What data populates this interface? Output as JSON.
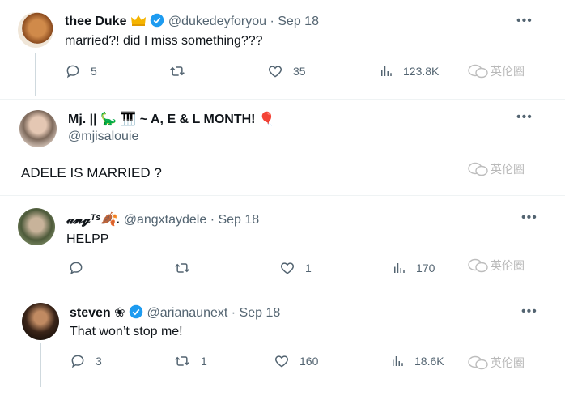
{
  "tweet1": {
    "name": "thee Duke",
    "handle": "@dukedeyforyou",
    "date": "· Sep 18",
    "text": "married?! did I miss something???",
    "replies": "5",
    "likes": "35",
    "views": "123.8K",
    "emoji": [
      "crown-icon",
      "verified-icon"
    ]
  },
  "tweet2": {
    "name": "Mj. || 🦕 🎹 ~ A, E & L MONTH! 🎈",
    "handle": "@mjisalouie",
    "text": "ADELE IS MARRIED ?"
  },
  "tweet3": {
    "name": "𝓪𝓷𝓰ᵀˢ🍂.",
    "handle": "@angxtaydele",
    "date": "· Sep 18",
    "text": "HELPP",
    "likes": "1",
    "views": "170"
  },
  "tweet4": {
    "name": "steven ❀",
    "handle": "@arianaunext",
    "date": "· Sep 18",
    "text": "That won’t stop me!",
    "replies": "3",
    "retweets": "1",
    "likes": "160",
    "views": "18.6K",
    "emoji": [
      "verified-icon"
    ]
  },
  "watermark": "英伦圈",
  "more_glyph": "•••",
  "colors": {
    "verified": "#1d9bf0",
    "muted": "#536471",
    "text": "#0f1419"
  }
}
